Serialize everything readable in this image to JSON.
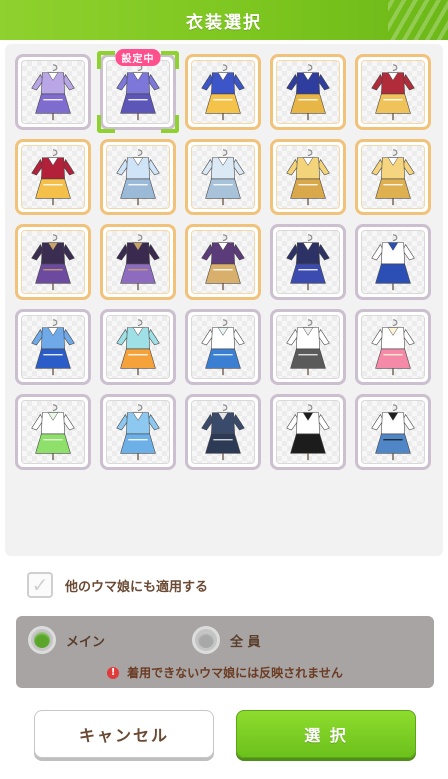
{
  "header": {
    "title": "衣装選択"
  },
  "grid": {
    "selected_badge": "設定中",
    "tiles": [
      {
        "frame": "silver",
        "colors": [
          "#b9a6e6",
          "#ffffff",
          "#7f6ccf"
        ],
        "selected": false
      },
      {
        "frame": "silver",
        "colors": [
          "#7c77d9",
          "#ffffff",
          "#5b56b8"
        ],
        "selected": true
      },
      {
        "frame": "gold",
        "colors": [
          "#3c55c9",
          "#ffffff",
          "#f6c34a"
        ],
        "selected": false
      },
      {
        "frame": "gold",
        "colors": [
          "#2f3e9e",
          "#ffffff",
          "#e7b646"
        ],
        "selected": false
      },
      {
        "frame": "gold",
        "colors": [
          "#b22b3a",
          "#ffffff",
          "#f0c35a"
        ],
        "selected": false
      },
      {
        "frame": "gold",
        "colors": [
          "#b3203a",
          "#ffffff",
          "#f5c04a"
        ],
        "selected": false
      },
      {
        "frame": "gold",
        "colors": [
          "#cfe4f6",
          "#ffffff",
          "#9bbad8"
        ],
        "selected": false
      },
      {
        "frame": "gold",
        "colors": [
          "#dbe9f5",
          "#ffffff",
          "#a8c2da"
        ],
        "selected": false
      },
      {
        "frame": "gold",
        "colors": [
          "#f4d47a",
          "#ffffff",
          "#d9a84a"
        ],
        "selected": false
      },
      {
        "frame": "gold",
        "colors": [
          "#f5d57f",
          "#ffffff",
          "#deb050"
        ],
        "selected": false
      },
      {
        "frame": "gold",
        "colors": [
          "#3b2d52",
          "#c9a36a",
          "#6b4aa0"
        ],
        "selected": false
      },
      {
        "frame": "gold",
        "colors": [
          "#3a2a4f",
          "#c7a06a",
          "#8d6cc0"
        ],
        "selected": false
      },
      {
        "frame": "gold",
        "colors": [
          "#5b3b7a",
          "#ffffff",
          "#d8b06b"
        ],
        "selected": false
      },
      {
        "frame": "silver",
        "colors": [
          "#2d3266",
          "#ffffff",
          "#3b4bb0"
        ],
        "selected": false
      },
      {
        "frame": "silver",
        "colors": [
          "#ffffff",
          "#2b4fb5",
          "#2b4fb5"
        ],
        "selected": false
      },
      {
        "frame": "silver",
        "colors": [
          "#6fa9e8",
          "#ffffff",
          "#2b5cc8"
        ],
        "selected": false
      },
      {
        "frame": "silver",
        "colors": [
          "#9fe0e6",
          "#ffffff",
          "#f6a23a"
        ],
        "selected": false
      },
      {
        "frame": "silver",
        "colors": [
          "#ffffff",
          "#e7f4f4",
          "#3a7fd1"
        ],
        "selected": false
      },
      {
        "frame": "silver",
        "colors": [
          "#ffffff",
          "#f0f0f0",
          "#5a5a5a"
        ],
        "selected": false
      },
      {
        "frame": "silver",
        "colors": [
          "#ffffff",
          "#fff4d6",
          "#f58aa8"
        ],
        "selected": false
      },
      {
        "frame": "silver",
        "colors": [
          "#ffffff",
          "#eaf8e6",
          "#8fe06a"
        ],
        "selected": false
      },
      {
        "frame": "silver",
        "colors": [
          "#8cc8f0",
          "#ffffff",
          "#6db0e8"
        ],
        "selected": false
      },
      {
        "frame": "silver",
        "colors": [
          "#394a6b",
          "#e6e6e6",
          "#2d3a55"
        ],
        "selected": false
      },
      {
        "frame": "silver",
        "colors": [
          "#ffffff",
          "#1c1c1c",
          "#1c1c1c"
        ],
        "selected": false
      },
      {
        "frame": "silver",
        "colors": [
          "#ffffff",
          "#1f1f1f",
          "#4e86c7"
        ],
        "selected": false
      }
    ]
  },
  "apply": {
    "label": "他のウマ娘にも適用する",
    "checked": true
  },
  "target": {
    "options": [
      {
        "label": "メイン",
        "selected": true
      },
      {
        "label": "全 員",
        "selected": false
      }
    ],
    "note": "着用できないウマ娘には反映されません"
  },
  "buttons": {
    "cancel": "キャンセル",
    "select": "選 択"
  },
  "colors": {
    "accent": "#7cc51f",
    "badge": "#ff4f8d",
    "text": "#6b4a34"
  }
}
